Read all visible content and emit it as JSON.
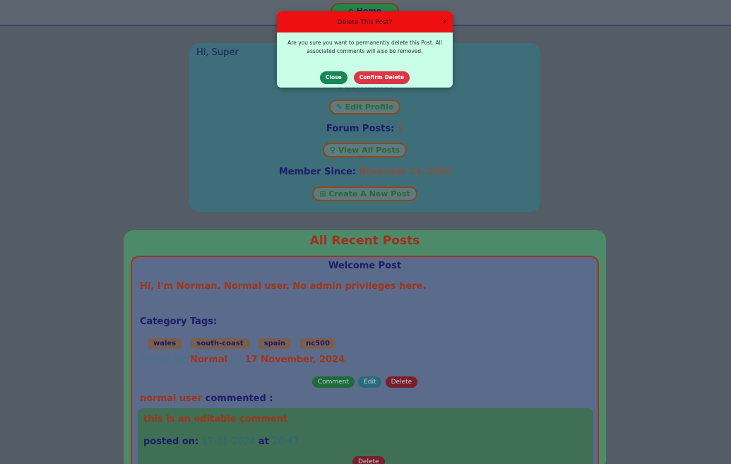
{
  "topbar": {
    "home_label": "Home"
  },
  "profile": {
    "greeting": "Hi, Super",
    "username_label": "Username:",
    "edit_profile": "Edit Profile",
    "forum_posts_label": "Forum Posts:",
    "forum_posts_value": "1",
    "view_all_posts": "View All Posts",
    "member_since_label": "Member Since:",
    "member_since_value": "November 14, 2024",
    "create_post": "Create A New Post"
  },
  "recent": {
    "title": "All Recent Posts",
    "post": {
      "title": "Welcome Post",
      "body": "Hi, I'm Norman. Normal user. No admin privileges here.",
      "category_label": "Category Tags:",
      "tags": [
        "wales",
        "south-coast",
        "spain",
        "nc500"
      ],
      "posted_by_label": "Posted by:",
      "author": "Normal",
      "on_label": "on",
      "date": "17 November, 2024",
      "actions": {
        "comment": "Comment",
        "edit": "Edit",
        "delete": "Delete"
      },
      "comment": {
        "author": "normal user",
        "commented_label": "commented :",
        "text": "this is an editable comment",
        "posted_on_label": "posted on:",
        "date": "17-11-2024",
        "at_label": "at",
        "time": "20:47",
        "delete": "Delete"
      }
    }
  },
  "modal": {
    "title": "Delete This Post?",
    "close_glyph": "x",
    "message": "Are you sure you want to permanently delete this Post. All associated comments will also be removed.",
    "close_button": "Close",
    "confirm_button": "Confirm Delete"
  },
  "colors": {
    "modal_header": "#ee1010",
    "modal_body": "#c8ffe6",
    "close_button": "#198754",
    "confirm_button": "#dc3545"
  }
}
